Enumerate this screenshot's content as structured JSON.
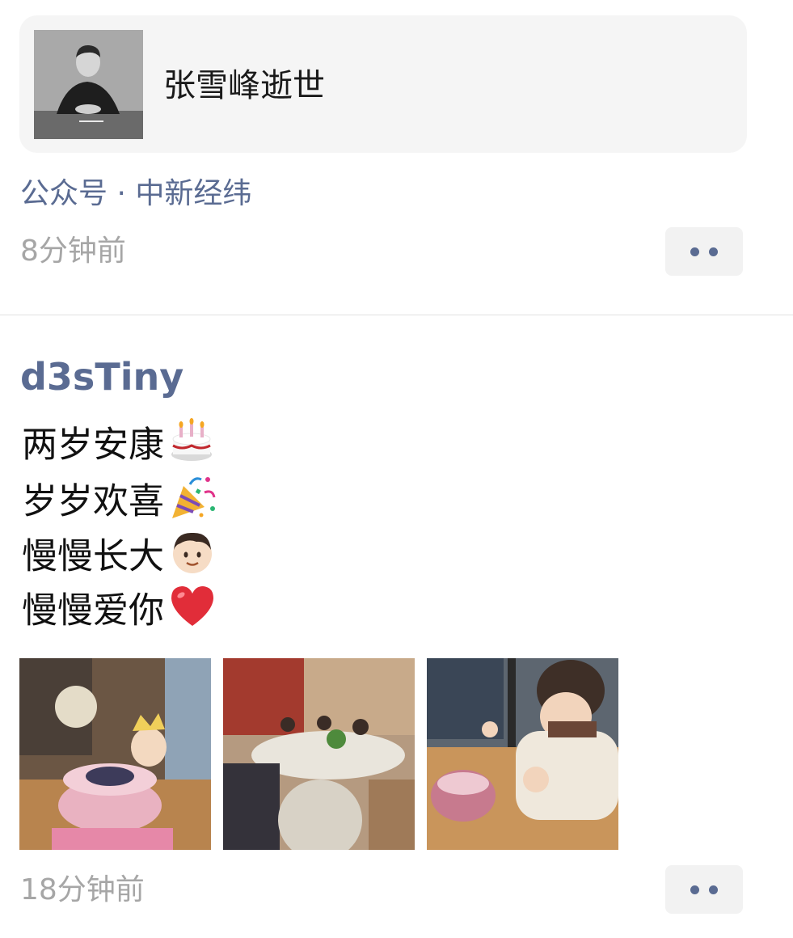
{
  "post1": {
    "card_title": "张雪峰逝世",
    "source": "公众号 · 中新经纬",
    "time": "8分钟前",
    "thumbnail_icon": "person-photo"
  },
  "post2": {
    "username": "d3sTiny",
    "lines": [
      {
        "text": "两岁安康",
        "emoji": "birthday-cake-icon"
      },
      {
        "text": "岁岁欢喜",
        "emoji": "party-popper-icon"
      },
      {
        "text": "慢慢长大",
        "emoji": "boy-face-icon"
      },
      {
        "text": "慢慢爱你",
        "emoji": "red-heart-icon"
      }
    ],
    "photos": [
      "birthday-cake-photo",
      "family-dinner-photo",
      "child-eating-cake-photo"
    ],
    "time": "18分钟前"
  },
  "colors": {
    "link": "#5a6b92",
    "timestamp": "#a6a6a6",
    "card_bg": "#f5f5f5"
  }
}
